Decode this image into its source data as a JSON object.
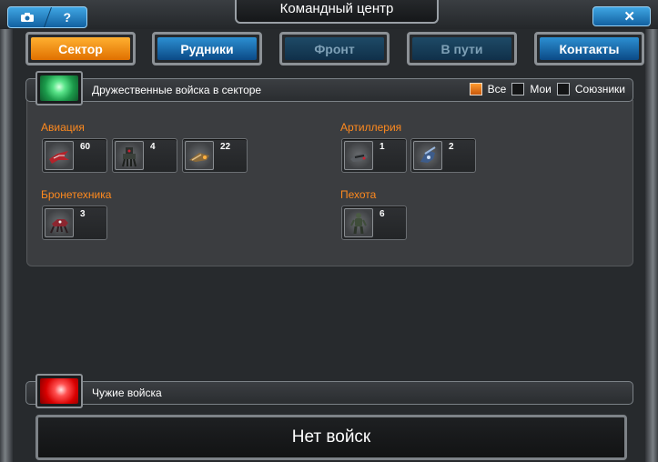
{
  "window": {
    "title": "Командный центр",
    "camera_icon": "camera-icon",
    "help_label": "?",
    "close_label": "✕"
  },
  "tabs": [
    {
      "label": "Сектор",
      "state": "active"
    },
    {
      "label": "Рудники",
      "state": "normal"
    },
    {
      "label": "Фронт",
      "state": "disabled"
    },
    {
      "label": "В пути",
      "state": "disabled"
    },
    {
      "label": "Контакты",
      "state": "normal"
    }
  ],
  "friendly": {
    "title": "Дружественные войска в секторе",
    "filters": [
      {
        "label": "Все",
        "checked": true
      },
      {
        "label": "Мои",
        "checked": false
      },
      {
        "label": "Союзники",
        "checked": false
      }
    ],
    "groups": [
      {
        "name": "Авиация",
        "units": [
          {
            "icon": "red-aircraft-icon",
            "count": "60"
          },
          {
            "icon": "mech-walker-icon",
            "count": "4"
          },
          {
            "icon": "bomber-aircraft-icon",
            "count": "22"
          }
        ]
      },
      {
        "name": "Артиллерия",
        "units": [
          {
            "icon": "artillery-drone-icon",
            "count": "1"
          },
          {
            "icon": "blue-artillery-icon",
            "count": "2"
          }
        ]
      },
      {
        "name": "Бронетехника",
        "units": [
          {
            "icon": "red-tank-icon",
            "count": "3"
          }
        ]
      },
      {
        "name": "Пехота",
        "units": [
          {
            "icon": "soldier-icon",
            "count": "6"
          }
        ]
      }
    ]
  },
  "hostile": {
    "title": "Чужие войска",
    "empty_label": "Нет войск"
  },
  "colors": {
    "accent_orange": "#ff8a1e",
    "tab_blue": "#2c8fd2",
    "friendly_green": "#3ec86e",
    "hostile_red": "#e80000"
  }
}
